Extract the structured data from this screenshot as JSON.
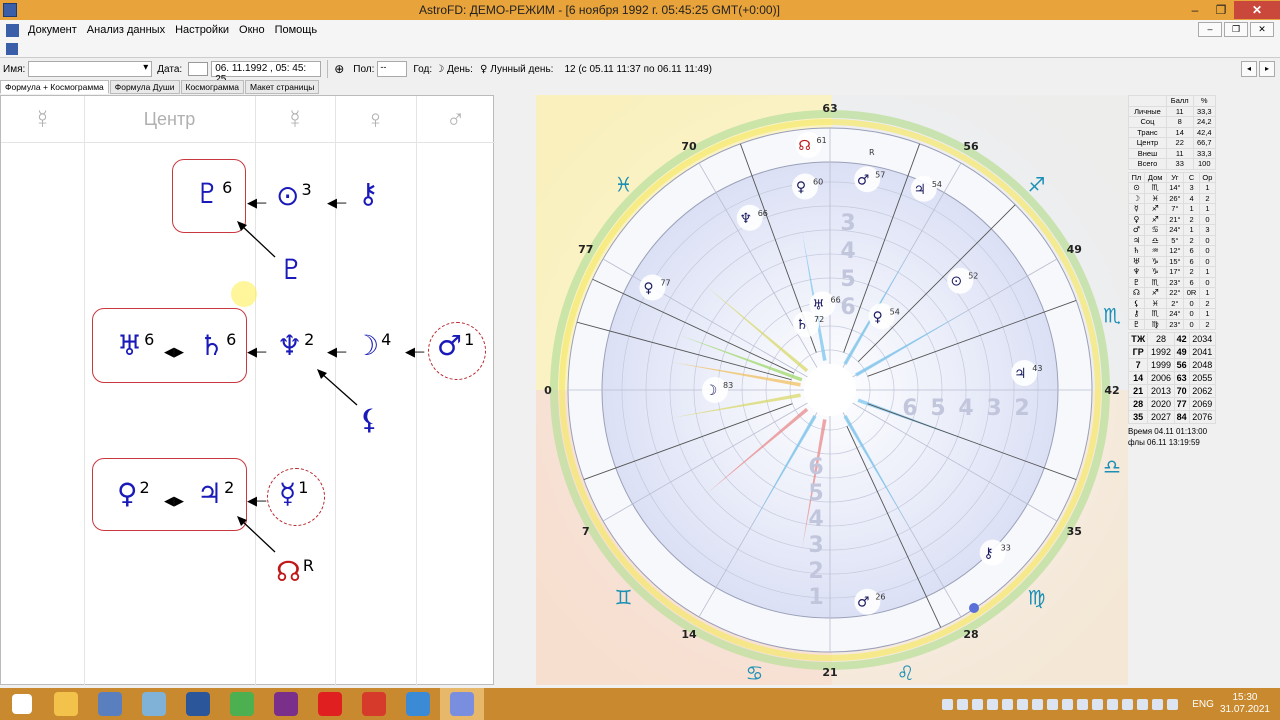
{
  "window": {
    "title": "AstroFD: ДЕМО-РЕЖИМ - [6 ноября 1992 г. 05:45:25 GMT(+0:00)]",
    "minimize": "–",
    "maximize": "❐",
    "close": "✕"
  },
  "menu": {
    "items": [
      "Документ",
      "Анализ данных",
      "Настройки",
      "Окно",
      "Помощь"
    ],
    "mdi": [
      "–",
      "❐",
      "✕"
    ]
  },
  "toolbar": {
    "name_label": "Имя:",
    "name_value": "",
    "date_label": "Дата:",
    "date_value": "06. 11.1992 , 05: 45: 25",
    "sex_label": "Пол:",
    "sex_value": "--",
    "year_label": "Год:",
    "day_label": "День:",
    "lunar_label": "Лунный день:",
    "lunar_value": "12 (с 05.11 11:37 по 06.11 11:49)",
    "nav_prev": "◂",
    "nav_next": "▸"
  },
  "tabs": [
    "Формула + Космограмма",
    "Формула Души",
    "Космограмма",
    "Макет страницы"
  ],
  "formula": {
    "headers": [
      "☿",
      "Центр",
      "☿",
      "♀",
      "♂"
    ],
    "row1": {
      "pluto": "♇",
      "pluto_n": "6",
      "sun": "⊙",
      "sun_n": "3",
      "chiron": "⚷",
      "proserpina": "♇"
    },
    "row2": {
      "uranus": "♅",
      "uranus_n": "6",
      "saturn": "♄",
      "saturn_n": "6",
      "neptune": "♆",
      "neptune_n": "2",
      "moon": "☽",
      "moon_n": "4",
      "mars": "♂",
      "mars_n": "1",
      "lilith": "⚸"
    },
    "row3": {
      "venus": "♀",
      "venus_n": "2",
      "jupiter": "♃",
      "jupiter_n": "2",
      "mercury": "☿",
      "mercury_n": "1",
      "node": "☊",
      "node_r": "R"
    }
  },
  "chart": {
    "degree_labels": [
      "63",
      "56",
      "49",
      "42",
      "35",
      "28",
      "21",
      "14",
      "7",
      "0",
      "77",
      "70"
    ],
    "signs": [
      "♑",
      "♐",
      "♏",
      "♎",
      "♍",
      "♌",
      "♋",
      "♊",
      "♉",
      "♈",
      "♓",
      "♒"
    ],
    "planets": [
      {
        "g": "♆",
        "n": "66"
      },
      {
        "g": "♀",
        "n": "60"
      },
      {
        "g": "♂",
        "n": "57"
      },
      {
        "g": "♃",
        "n": "54"
      },
      {
        "g": "☊",
        "n": "61"
      },
      {
        "g": "⊙",
        "n": "52"
      },
      {
        "g": "♃",
        "n": "43"
      },
      {
        "g": "♅",
        "n": "66"
      },
      {
        "g": "♄",
        "n": "72"
      },
      {
        "g": "♀",
        "n": "54"
      },
      {
        "g": "☽",
        "n": "83"
      },
      {
        "g": "♀",
        "n": "77"
      },
      {
        "g": "⚷",
        "n": "33"
      },
      {
        "g": "♂",
        "n": "26"
      }
    ],
    "node_r": "R",
    "ruler_up": [
      "3",
      "4",
      "5",
      "6"
    ],
    "ruler_right": [
      "6",
      "5",
      "4",
      "3",
      "2"
    ],
    "ruler_down": [
      "6",
      "5",
      "4",
      "3",
      "2",
      "1"
    ]
  },
  "stats": {
    "header": [
      "",
      "Балл",
      "%"
    ],
    "rows": [
      [
        "Личные",
        "11",
        "33,3"
      ],
      [
        "Соц",
        "8",
        "24,2"
      ],
      [
        "Транс",
        "14",
        "42,4"
      ],
      [
        "Центр",
        "22",
        "66,7"
      ],
      [
        "Внеш",
        "11",
        "33,3"
      ],
      [
        "Всего",
        "33",
        "100"
      ]
    ]
  },
  "positions": {
    "header": [
      "Пл",
      "Дом",
      "Уг",
      "С",
      "Ор"
    ],
    "rows": [
      [
        "⊙",
        "♏",
        "14°",
        "3",
        "1"
      ],
      [
        "☽",
        "♓",
        "26°",
        "4",
        "2"
      ],
      [
        "☿",
        "♐",
        "7°",
        "1",
        "1"
      ],
      [
        "♀",
        "♐",
        "21°",
        "2",
        "0"
      ],
      [
        "♂",
        "♋",
        "24°",
        "1",
        "3"
      ],
      [
        "♃",
        "♎",
        "5°",
        "2",
        "0"
      ],
      [
        "♄",
        "♒",
        "12°",
        "6",
        "0"
      ],
      [
        "♅",
        "♑",
        "15°",
        "6",
        "0"
      ],
      [
        "♆",
        "♑",
        "17°",
        "2",
        "1"
      ],
      [
        "♇",
        "♏",
        "23°",
        "6",
        "0"
      ],
      [
        "☊",
        "♐",
        "22°",
        "0R",
        "1"
      ],
      [
        "⚸",
        "♓",
        "2°",
        "0",
        "2"
      ],
      [
        "⚷",
        "♏",
        "24°",
        "0",
        "1"
      ],
      [
        "♇",
        "♍",
        "23°",
        "0",
        "2"
      ]
    ]
  },
  "years": {
    "rows": [
      [
        "ТЖ",
        "28",
        "42",
        "2034"
      ],
      [
        "ГР",
        "1992",
        "49",
        "2041"
      ],
      [
        "7",
        "1999",
        "56",
        "2048"
      ],
      [
        "14",
        "2006",
        "63",
        "2055"
      ],
      [
        "21",
        "2013",
        "70",
        "2062"
      ],
      [
        "28",
        "2020",
        "77",
        "2069"
      ],
      [
        "35",
        "2027",
        "84",
        "2076"
      ]
    ]
  },
  "times": {
    "time_line": "Время 04.11 01:13:00",
    "fly_line": "флы 06.11 13:19:59"
  },
  "taskbar": {
    "apps": [
      {
        "name": "start",
        "color": "#ffffff"
      },
      {
        "name": "explorer",
        "color": "#f3c24a"
      },
      {
        "name": "calculator",
        "color": "#5a7fbf"
      },
      {
        "name": "notepad",
        "color": "#7fb2d6"
      },
      {
        "name": "word",
        "color": "#2b579a"
      },
      {
        "name": "chrome",
        "color": "#4caf50"
      },
      {
        "name": "screen",
        "color": "#7a2f8a"
      },
      {
        "name": "opera",
        "color": "#e02020"
      },
      {
        "name": "vector",
        "color": "#d63a2a"
      },
      {
        "name": "edit",
        "color": "#3a8ad6"
      },
      {
        "name": "astrofd",
        "color": "#7a8ee0"
      }
    ],
    "lang": "ENG",
    "time": "15:30",
    "date": "31.07.2021"
  }
}
